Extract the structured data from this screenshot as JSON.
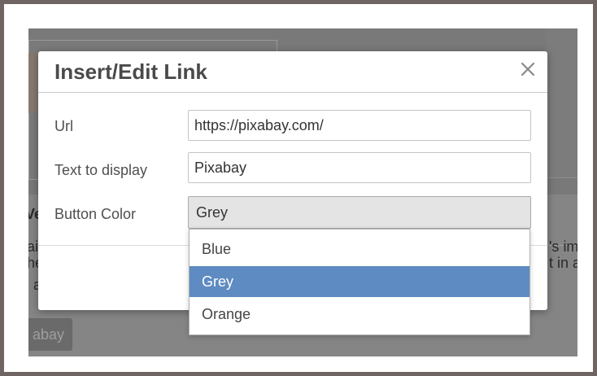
{
  "background_page": {
    "heading_fragment": "Ve",
    "text_left_line1": "ai",
    "text_left_line2": "he",
    "text_left_line3": "a",
    "text_right_line1": "'s im",
    "text_right_line2": "t in a",
    "button_fragment": "abay"
  },
  "dialog": {
    "title": "Insert/Edit Link",
    "close_symbol": "×",
    "fields": {
      "url": {
        "label": "Url",
        "value": "https://pixabay.com/"
      },
      "text": {
        "label": "Text to display",
        "value": "Pixabay"
      },
      "color": {
        "label": "Button Color",
        "value": "Grey"
      }
    }
  },
  "dropdown": {
    "options": [
      "Blue",
      "Grey",
      "Orange"
    ],
    "selected": "Grey"
  },
  "colors": {
    "overlay": "#797979",
    "selected_option": "#5e8bc1",
    "frame_border": "#6f6563"
  }
}
